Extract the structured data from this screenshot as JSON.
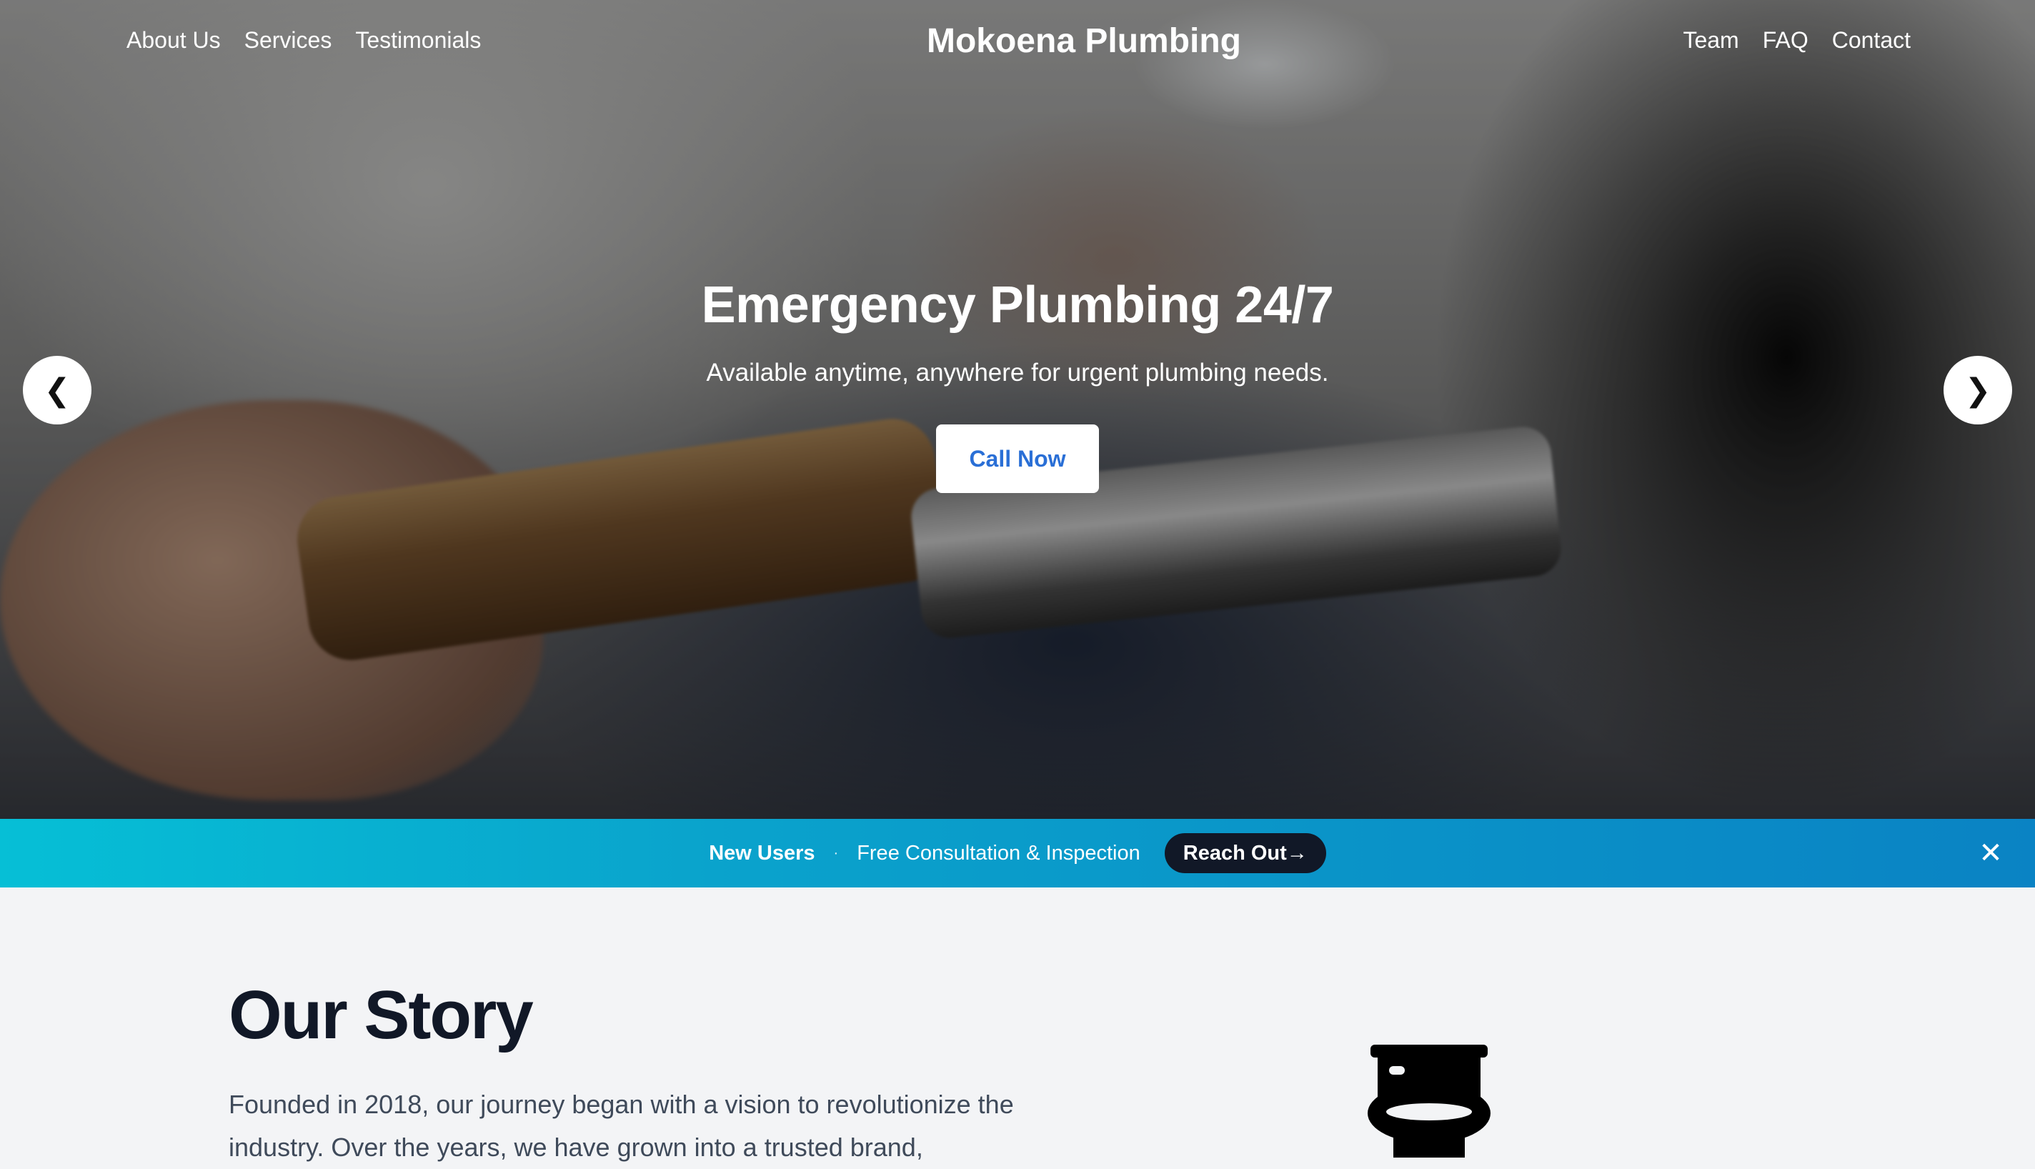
{
  "nav": {
    "left": [
      "About Us",
      "Services",
      "Testimonials"
    ],
    "brand": "Mokoena Plumbing",
    "right": [
      "Team",
      "FAQ",
      "Contact"
    ]
  },
  "hero": {
    "title": "Emergency Plumbing 24/7",
    "subtitle": "Available anytime, anywhere for urgent plumbing needs.",
    "cta_label": "Call Now",
    "prev_arrow": "❮",
    "next_arrow": "❯"
  },
  "promo": {
    "title": "New Users",
    "separator": "·",
    "offer": "Free Consultation & Inspection",
    "button_label": "Reach Out→",
    "close_glyph": "✕",
    "colors": {
      "start": "#06bfd6",
      "end": "#0a83c4",
      "button": "#111827"
    }
  },
  "story": {
    "title": "Our Story",
    "text": "Founded in 2018, our journey began with a vision to revolutionize the industry. Over the years, we have grown into a trusted brand,",
    "icon": "toilet-icon"
  },
  "colors": {
    "cta_text": "#2a6fd6",
    "heading": "#111827",
    "body_text": "#3f4a5a",
    "page_bg": "#f3f4f6"
  }
}
